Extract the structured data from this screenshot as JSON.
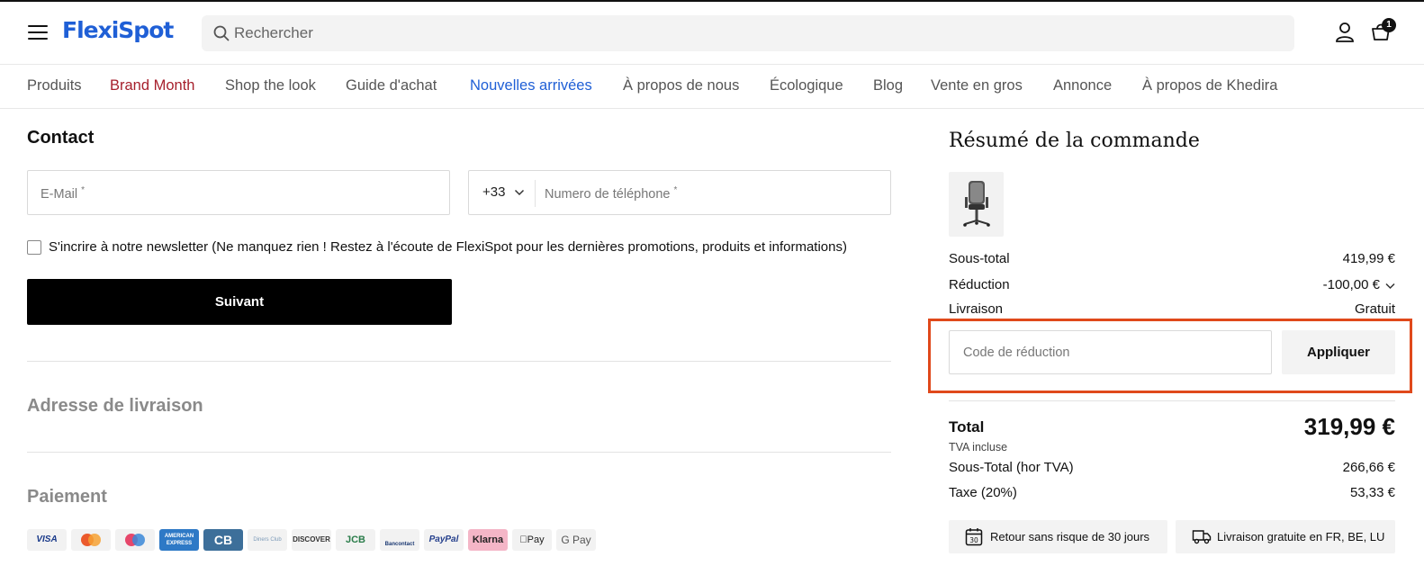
{
  "header": {
    "logo": "FlexiSpot",
    "search_placeholder": "Rechercher",
    "cart_count": "1"
  },
  "nav": {
    "items": [
      {
        "label": "Produits",
        "color": "#555555"
      },
      {
        "label": "Brand Month",
        "color": "#a61f2c"
      },
      {
        "label": "Shop the look",
        "color": "#555555"
      },
      {
        "label": "Guide d'achat",
        "color": "#555555"
      },
      {
        "label": "Nouvelles arrivées",
        "color": "#1f5fd6"
      },
      {
        "label": "À propos de nous",
        "color": "#555555"
      },
      {
        "label": "Écologique",
        "color": "#555555"
      },
      {
        "label": "Blog",
        "color": "#555555"
      },
      {
        "label": "Vente en gros",
        "color": "#555555"
      },
      {
        "label": "Annonce",
        "color": "#555555"
      },
      {
        "label": "À propos de Khedira",
        "color": "#555555"
      }
    ]
  },
  "contact": {
    "title": "Contact",
    "email_placeholder": "E-Mail",
    "required_mark": "*",
    "country_code": "+33",
    "phone_placeholder": "Numero de téléphone",
    "newsletter_label": "S'incrire à notre newsletter (Ne manquez rien ! Restez à l'écoute de FlexiSpot pour les dernières promotions, produits et informations)",
    "newsletter_checked": false,
    "next_button": "Suivant"
  },
  "sections": {
    "shipping_title": "Adresse de livraison",
    "payment_title": "Paiement"
  },
  "payment_methods": [
    "VISA",
    "Mastercard",
    "Maestro",
    "AMERICAN EXPRESS",
    "CB",
    "Diners Club",
    "DISCOVER",
    "JCB",
    "Bancontact",
    "PayPal",
    "Klarna",
    "Apple Pay",
    "G Pay"
  ],
  "summary": {
    "title": "Résumé de la commande",
    "subtotal_label": "Sous-total",
    "subtotal_value": "419,99 €",
    "discount_label": "Réduction",
    "discount_value": "-100,00 €",
    "shipping_label": "Livraison",
    "shipping_value": "Gratuit",
    "code_placeholder": "Code de réduction",
    "apply_button": "Appliquer",
    "total_label": "Total",
    "total_value": "319,99 €",
    "tva_note": "TVA incluse",
    "subtotal_ht_label": "Sous-Total (hor TVA)",
    "subtotal_ht_value": "266,66 €",
    "tax_label": "Taxe (20%)",
    "tax_value": "53,33 €",
    "badge_return": "Retour sans risque de 30 jours",
    "badge_return_icon_text": "30",
    "badge_shipping": "Livraison gratuite en FR, BE, LU"
  },
  "colors": {
    "brand_blue": "#1f5fd6",
    "highlight_red": "#e0491b",
    "button_black": "#000000"
  }
}
